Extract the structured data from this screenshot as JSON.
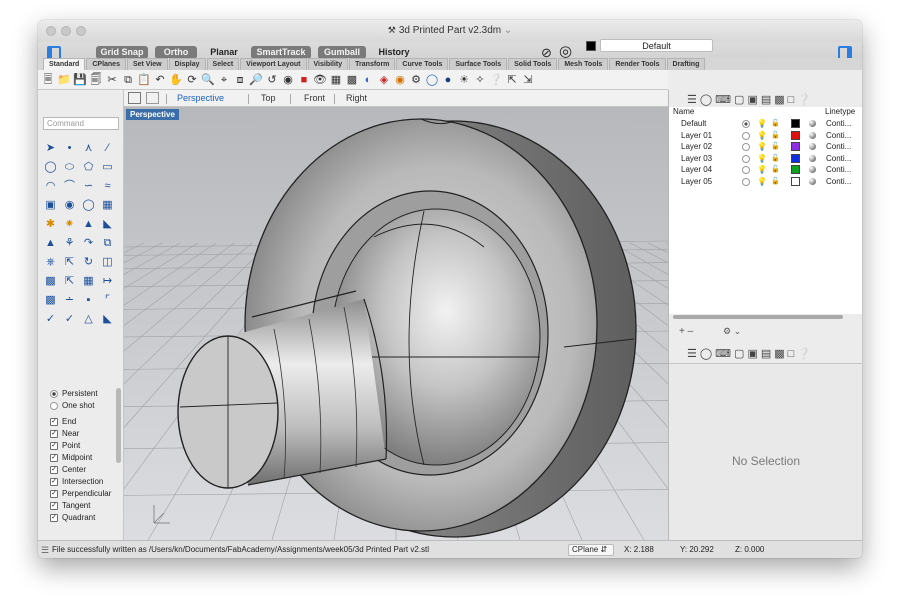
{
  "window": {
    "title": "3d Printed Part v2.3dm",
    "title_suffix": "⌄"
  },
  "toolbar": {
    "toggles": [
      {
        "label": "Grid Snap",
        "on": true
      },
      {
        "label": "Ortho",
        "on": true
      },
      {
        "label": "Planar",
        "on": false
      },
      {
        "label": "SmartTrack",
        "on": true
      },
      {
        "label": "Gumball",
        "on": true
      },
      {
        "label": "History",
        "on": false
      }
    ],
    "current_layer": "Default",
    "layer_color": "#000000"
  },
  "tabs": [
    "Standard",
    "CPlanes",
    "Set View",
    "Display",
    "Select",
    "Viewport Layout",
    "Visibility",
    "Transform",
    "Curve Tools",
    "Surface Tools",
    "Solid Tools",
    "Mesh Tools",
    "Render Tools",
    "Drafting"
  ],
  "active_tab": "Standard",
  "command": {
    "placeholder": "Command"
  },
  "viewport": {
    "tabs": [
      "Perspective",
      "Top",
      "Front",
      "Right"
    ],
    "active": "Perspective",
    "label": "Perspective",
    "bg_top": "#b6b8bc",
    "bg_bottom": "#dcdde0"
  },
  "osnaps": {
    "modes": [
      {
        "label": "Persistent",
        "on": true
      },
      {
        "label": "One shot",
        "on": false
      }
    ],
    "items": [
      "End",
      "Near",
      "Point",
      "Midpoint",
      "Center",
      "Intersection",
      "Perpendicular",
      "Tangent",
      "Quadrant"
    ]
  },
  "layers": {
    "header_name": "Name",
    "header_linetype": "Linetype",
    "rows": [
      {
        "name": "Default",
        "color": "#000000",
        "linetype": "Conti...",
        "current": true
      },
      {
        "name": "Layer 01",
        "color": "#e01010",
        "linetype": "Conti...",
        "current": false
      },
      {
        "name": "Layer 02",
        "color": "#8b2fe0",
        "linetype": "Conti...",
        "current": false
      },
      {
        "name": "Layer 03",
        "color": "#1030e0",
        "linetype": "Conti...",
        "current": false
      },
      {
        "name": "Layer 04",
        "color": "#10a020",
        "linetype": "Conti...",
        "current": false
      },
      {
        "name": "Layer 05",
        "color": "#ffffff",
        "linetype": "Conti...",
        "current": false
      }
    ]
  },
  "properties": {
    "empty_text": "No Selection"
  },
  "status": {
    "message": "File successfully written as /Users/kn/Documents/FabAcademy/Assignments/week05/3d Printed Part v2.stl",
    "cplane": "CPlane",
    "x": "X: 2.188",
    "y": "Y: 20.292",
    "z": "Z: 0.000"
  }
}
